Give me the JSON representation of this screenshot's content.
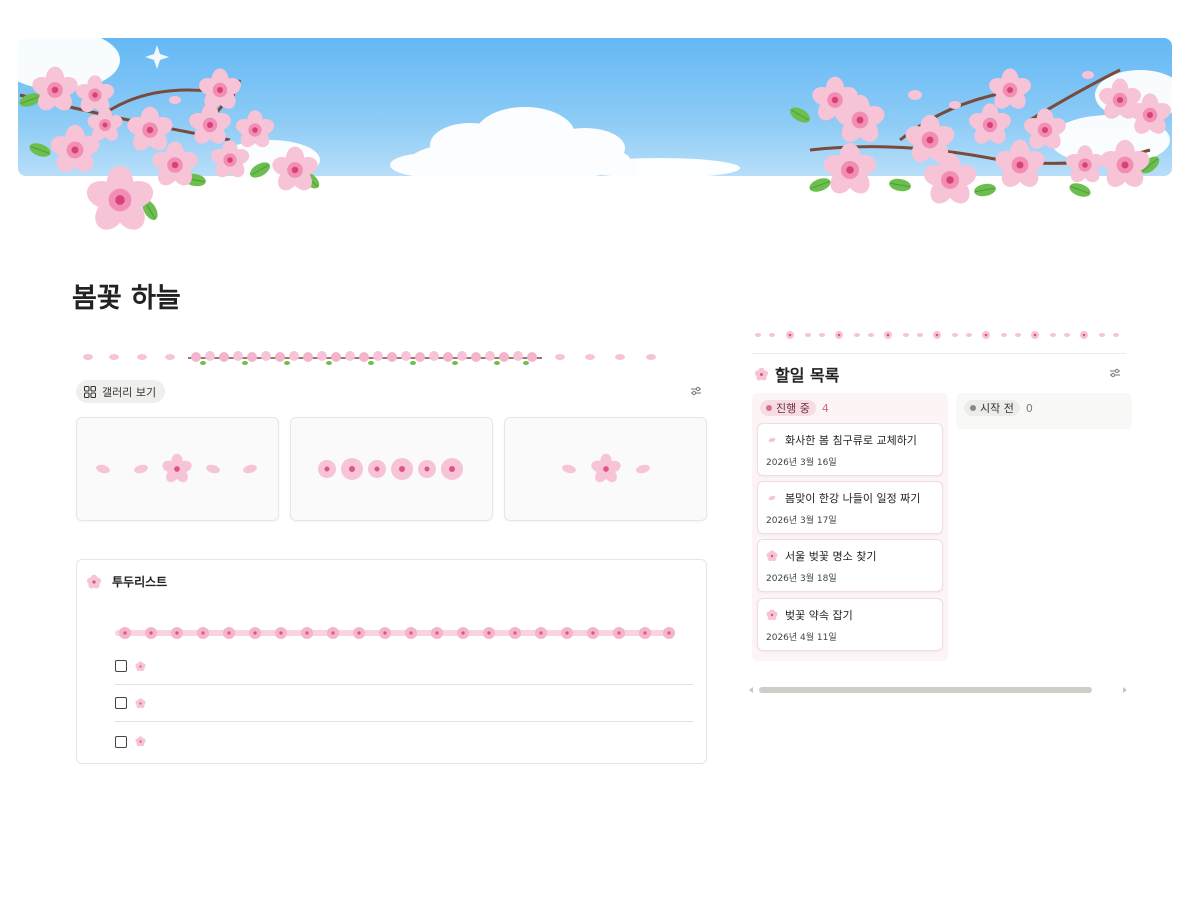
{
  "page": {
    "title": "봄꽃 하늘"
  },
  "gallery": {
    "view_label": "갤러리 보기",
    "view_icon": "gallery-grid-icon",
    "settings_icon": "sliders-icon"
  },
  "todo": {
    "title": "투두리스트",
    "items": [
      {
        "checked": false,
        "text": ""
      },
      {
        "checked": false,
        "text": ""
      },
      {
        "checked": false,
        "text": ""
      }
    ]
  },
  "board": {
    "title": "할일 목록",
    "settings_icon": "sliders-icon",
    "columns": [
      {
        "label": "진행 중",
        "count": "4",
        "color": "#d6728c",
        "cards": [
          {
            "title": "화사한 봄 침구류로 교체하기",
            "date": "2026년 3월 16일"
          },
          {
            "title": "봄맞이 한강 나들이 일정 짜기",
            "date": "2026년 3월 17일"
          },
          {
            "title": "서울 벚꽃 명소 찾기",
            "date": "2026년 3월 18일"
          },
          {
            "title": "벚꽃 약속 잡기",
            "date": "2026년 4월 11일"
          }
        ]
      },
      {
        "label": "시작 전",
        "count": "0",
        "color": "#8a8984",
        "cards": []
      }
    ]
  },
  "colors": {
    "sky": "#64b8f5",
    "blossom": "#f6b9cf",
    "blossom_center": "#e0528a",
    "leaf": "#5fb34a"
  }
}
